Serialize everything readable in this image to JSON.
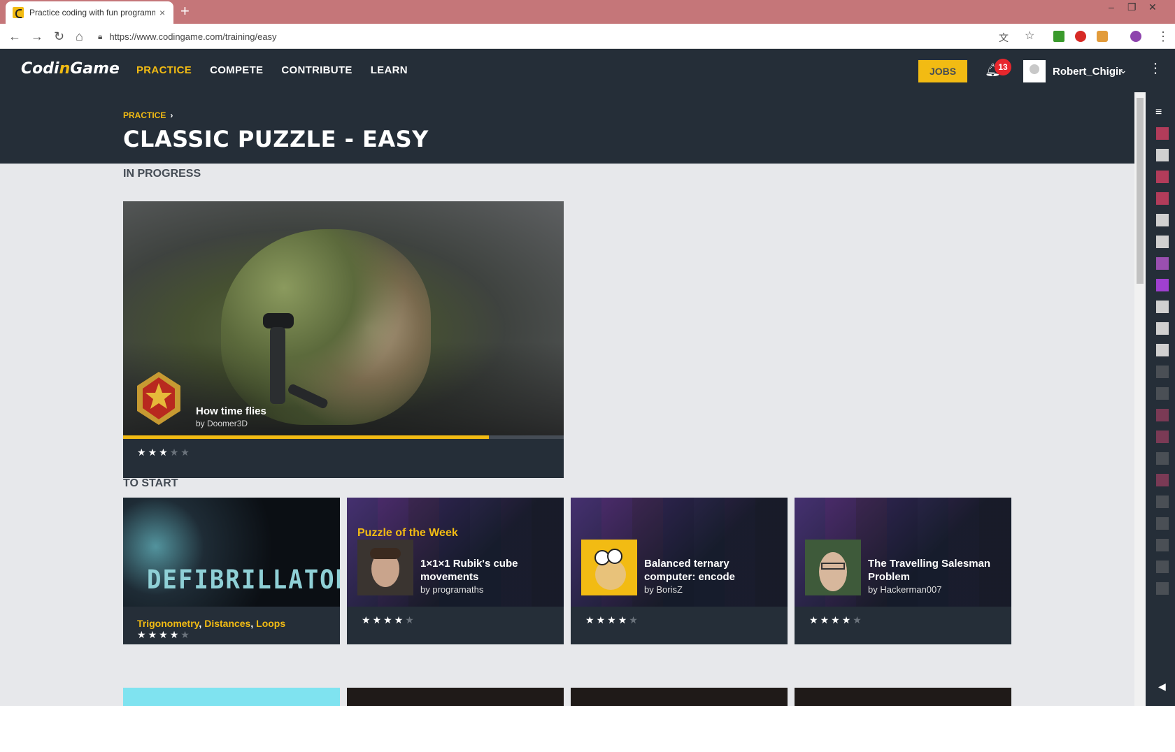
{
  "browser": {
    "tab_title": "Practice coding with fun programming challenges",
    "new_tab": "+",
    "url": "https://www.codingame.com/training/easy"
  },
  "header": {
    "logo_part1": "Codi",
    "logo_part2": "n",
    "logo_part3": "Game",
    "nav": [
      "PRACTICE",
      "COMPETE",
      "CONTRIBUTE",
      "LEARN"
    ],
    "active_nav": "PRACTICE",
    "jobs": "JOBS",
    "notifications": "13",
    "username": "Robert_Chigir"
  },
  "page": {
    "breadcrumb": "PRACTICE",
    "title": "CLASSIC PUZZLE - EASY"
  },
  "in_progress": {
    "section_title": "IN PROGRESS",
    "puzzle": {
      "name": "How time flies",
      "author": "by Doomer3D",
      "progress": 0.83,
      "rating": 3
    }
  },
  "to_start": {
    "section_title": "TO START",
    "cards": [
      {
        "title_art": "DEFIBRILLATORS",
        "tags": [
          "Trigonometry",
          "Distances",
          "Loops"
        ],
        "rating": 4
      },
      {
        "badge": "Puzzle of the Week",
        "name": "1×1×1 Rubik's cube movements",
        "author": "by programaths",
        "rating": 4
      },
      {
        "name": "Balanced ternary computer: encode",
        "author": "by BorisZ",
        "rating": 4
      },
      {
        "name": "The Travelling Salesman Problem",
        "author": "by Hackerman007",
        "rating": 4
      }
    ]
  },
  "colors": {
    "accent": "#f2bb13",
    "dark": "#252e38",
    "background": "#e7e8eb",
    "notification": "#e7272d"
  }
}
